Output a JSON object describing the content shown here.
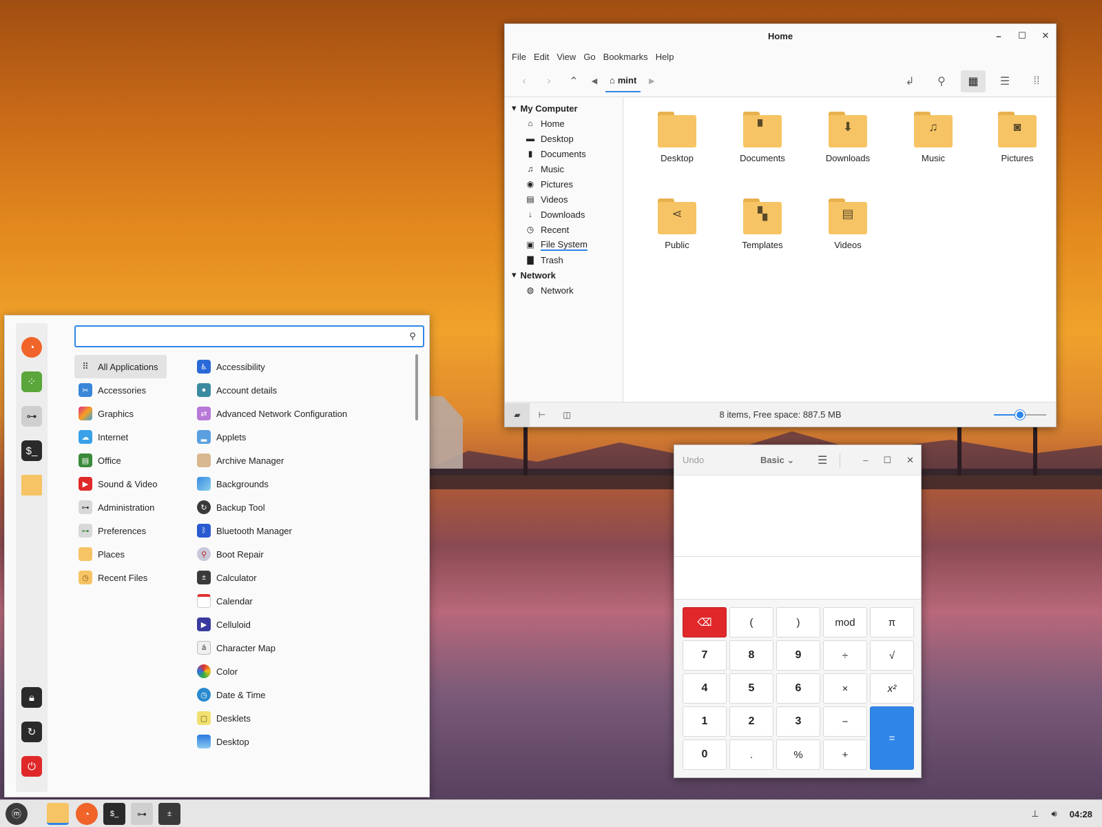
{
  "colors": {
    "accent": "#2f86e8",
    "folder": "#f6c464",
    "danger": "#e0282a"
  },
  "file_manager": {
    "title": "Home",
    "menu": [
      "File",
      "Edit",
      "View",
      "Go",
      "Bookmarks",
      "Help"
    ],
    "breadcrumb": "mint",
    "sidebar": {
      "my_computer": "My Computer",
      "items": [
        {
          "label": "Home",
          "icon": "home-icon"
        },
        {
          "label": "Desktop",
          "icon": "desktop-icon"
        },
        {
          "label": "Documents",
          "icon": "document-icon"
        },
        {
          "label": "Music",
          "icon": "music-icon"
        },
        {
          "label": "Pictures",
          "icon": "camera-icon"
        },
        {
          "label": "Videos",
          "icon": "film-icon"
        },
        {
          "label": "Downloads",
          "icon": "download-icon"
        },
        {
          "label": "Recent",
          "icon": "clock-icon"
        },
        {
          "label": "File System",
          "icon": "drive-icon"
        },
        {
          "label": "Trash",
          "icon": "trash-icon"
        }
      ],
      "network_header": "Network",
      "network_items": [
        {
          "label": "Network",
          "icon": "globe-icon"
        }
      ]
    },
    "folders": [
      {
        "label": "Desktop",
        "icon": ""
      },
      {
        "label": "Documents",
        "icon": "document-icon"
      },
      {
        "label": "Downloads",
        "icon": "download-icon"
      },
      {
        "label": "Music",
        "icon": "music-icon"
      },
      {
        "label": "Pictures",
        "icon": "camera-icon"
      },
      {
        "label": "Public",
        "icon": "share-icon"
      },
      {
        "label": "Templates",
        "icon": "template-icon"
      },
      {
        "label": "Videos",
        "icon": "film-icon"
      }
    ],
    "status": "8 items, Free space: 887.5 MB",
    "zoom_level_fraction": 0.45
  },
  "calculator": {
    "undo": "Undo",
    "mode": "Basic",
    "keys": [
      "",
      "(",
      ")",
      "mod",
      "π",
      "7",
      "8",
      "9",
      "÷",
      "√",
      "4",
      "5",
      "6",
      "×",
      "x²",
      "1",
      "2",
      "3",
      "−",
      "=",
      "0",
      ".",
      "%",
      "+"
    ]
  },
  "menu": {
    "search_placeholder": "",
    "categories": [
      {
        "label": "All Applications",
        "icon": "grid-icon"
      },
      {
        "label": "Accessories",
        "icon": "scissors-icon"
      },
      {
        "label": "Graphics",
        "icon": "graphics-icon"
      },
      {
        "label": "Internet",
        "icon": "cloud-icon"
      },
      {
        "label": "Office",
        "icon": "office-icon"
      },
      {
        "label": "Sound & Video",
        "icon": "play-icon"
      },
      {
        "label": "Administration",
        "icon": "toggle-icon"
      },
      {
        "label": "Preferences",
        "icon": "toggle-icon"
      },
      {
        "label": "Places",
        "icon": "folder-icon"
      },
      {
        "label": "Recent Files",
        "icon": "recent-folder-icon"
      }
    ],
    "apps": [
      {
        "label": "Accessibility",
        "icon": "accessibility-icon"
      },
      {
        "label": "Account details",
        "icon": "person-icon"
      },
      {
        "label": "Advanced Network Configuration",
        "icon": "network-icon"
      },
      {
        "label": "Applets",
        "icon": "applets-icon"
      },
      {
        "label": "Archive Manager",
        "icon": "archive-icon"
      },
      {
        "label": "Backgrounds",
        "icon": "backgrounds-icon"
      },
      {
        "label": "Backup Tool",
        "icon": "backup-icon"
      },
      {
        "label": "Bluetooth Manager",
        "icon": "bluetooth-icon"
      },
      {
        "label": "Boot Repair",
        "icon": "boot-repair-icon"
      },
      {
        "label": "Calculator",
        "icon": "calculator-icon"
      },
      {
        "label": "Calendar",
        "icon": "calendar-icon"
      },
      {
        "label": "Celluloid",
        "icon": "celluloid-icon"
      },
      {
        "label": "Character Map",
        "icon": "charmap-icon"
      },
      {
        "label": "Color",
        "icon": "color-icon"
      },
      {
        "label": "Date & Time",
        "icon": "clock-icon"
      },
      {
        "label": "Desklets",
        "icon": "desklets-icon"
      },
      {
        "label": "Desktop",
        "icon": "desktop-icon"
      }
    ],
    "favorites": [
      "firefox-icon",
      "software-manager-icon",
      "settings-toggle-icon",
      "terminal-icon",
      "folder-icon"
    ],
    "session": [
      "lock-icon",
      "logout-icon",
      "power-icon"
    ]
  },
  "taskbar": {
    "apps": [
      "menu-icon",
      "files-icon",
      "firefox-icon",
      "terminal-icon",
      "settings-toggle-icon",
      "calculator-icon"
    ],
    "clock": "04:28"
  }
}
